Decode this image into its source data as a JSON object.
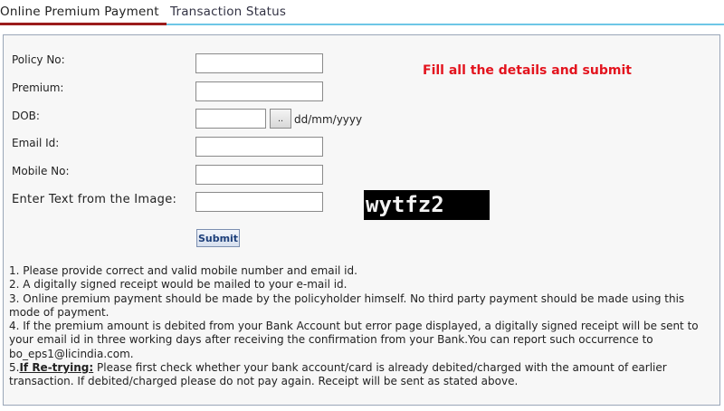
{
  "tabs": [
    {
      "label": "Online Premium Payment",
      "active": true
    },
    {
      "label": "Transaction Status",
      "active": false
    }
  ],
  "form": {
    "policy_no": {
      "label": "Policy No:",
      "value": ""
    },
    "premium": {
      "label": "Premium:",
      "value": ""
    },
    "dob": {
      "label": "DOB:",
      "value": "",
      "button_label": "..",
      "format_hint": "dd/mm/yyyy"
    },
    "email": {
      "label": "Email Id:",
      "value": ""
    },
    "mobile": {
      "label": "Mobile No:",
      "value": ""
    },
    "captcha": {
      "label": "Enter Text from the Image:",
      "value": "",
      "image_text": "wytfz2"
    },
    "submit_label": "Submit",
    "notice": "Fill all the details and submit"
  },
  "notes": {
    "n1": "1. Please provide correct and valid mobile number and email id.",
    "n2": "2. A digitally signed receipt would be mailed to your e-mail id.",
    "n3": "3. Online premium payment should be made by the policyholder himself. No third party payment should be made using this mode of payment.",
    "n4": "4. If the premium amount is debited from your Bank Account but error page displayed, a digitally signed receipt will be sent to your email id in three working days after receiving the confirmation from your Bank.You can report such occurrence to bo_eps1@licindia.com.",
    "n5_prefix": "5.",
    "n5_bold": "If Re-trying:",
    "n5_text": " Please first check whether your bank account/card is already debited/charged with the amount of earlier transaction. If debited/charged please do not pay again. Receipt will be sent as stated above."
  },
  "colors": {
    "notice": "#e3141e",
    "active_tab_underline": "#9b1c1c",
    "tab_rule": "#6ec6e6",
    "panel_border": "#9aa6b8"
  }
}
